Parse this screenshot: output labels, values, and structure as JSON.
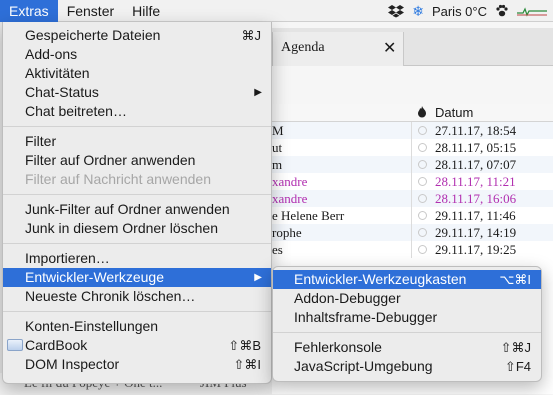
{
  "menubar": {
    "items": [
      "Extras",
      "Fenster",
      "Hilfe"
    ],
    "weather": "Paris 0°C"
  },
  "tab": {
    "label": "Agenda",
    "close": "✕"
  },
  "list": {
    "header_date": "Datum",
    "rows": [
      {
        "sender": "M",
        "date": "27.11.17, 18:54",
        "purple": false
      },
      {
        "sender": "ut",
        "date": "28.11.17, 05:15",
        "purple": false
      },
      {
        "sender": "m",
        "date": "28.11.17, 07:07",
        "purple": false
      },
      {
        "sender": "xandre",
        "date": "28.11.17, 11:21",
        "purple": true
      },
      {
        "sender": "xandre",
        "date": "28.11.17, 16:06",
        "purple": true
      },
      {
        "sender": "e Helene Berr",
        "date": "29.11.17, 11:46",
        "purple": false
      },
      {
        "sender": "rophe",
        "date": "29.11.17, 14:19",
        "purple": false
      },
      {
        "sender": "es",
        "date": "29.11.17, 19:25",
        "purple": false
      }
    ]
  },
  "bottom_fragment": {
    "left": "Le fil du Popeye + One t...",
    "right": "JIM Plus",
    "date": "02.12.17, 08:05"
  },
  "menu": {
    "groups": [
      [
        {
          "label": "Gespeicherte Dateien",
          "shortcut": "⌘J"
        },
        {
          "label": "Add-ons"
        },
        {
          "label": "Aktivitäten"
        },
        {
          "label": "Chat-Status",
          "submenu": true
        },
        {
          "label": "Chat beitreten…"
        }
      ],
      [
        {
          "label": "Filter"
        },
        {
          "label": "Filter auf Ordner anwenden"
        },
        {
          "label": "Filter auf Nachricht anwenden",
          "disabled": true
        }
      ],
      [
        {
          "label": "Junk-Filter auf Ordner anwenden"
        },
        {
          "label": "Junk in diesem Ordner löschen"
        }
      ],
      [
        {
          "label": "Importieren…"
        },
        {
          "label": "Entwickler-Werkzeuge",
          "submenu": true,
          "highlighted": true
        },
        {
          "label": "Neueste Chronik löschen…"
        }
      ],
      [
        {
          "label": "Konten-Einstellungen"
        },
        {
          "label": "CardBook",
          "shortcut": "⇧⌘B",
          "icon": "cardbook-icon"
        },
        {
          "label": "DOM Inspector",
          "shortcut": "⇧⌘I"
        }
      ]
    ]
  },
  "submenu": {
    "groups": [
      [
        {
          "label": "Entwickler-Werkzeugkasten",
          "shortcut": "⌥⌘I",
          "highlighted": true
        },
        {
          "label": "Addon-Debugger"
        },
        {
          "label": "Inhaltsframe-Debugger"
        }
      ],
      [
        {
          "label": "Fehlerkonsole",
          "shortcut": "⇧⌘J"
        },
        {
          "label": "JavaScript-Umgebung",
          "shortcut": "⇧F4"
        }
      ]
    ]
  },
  "colors": {
    "highlight": "#2e6fd8",
    "purple": "#b12fb0"
  }
}
